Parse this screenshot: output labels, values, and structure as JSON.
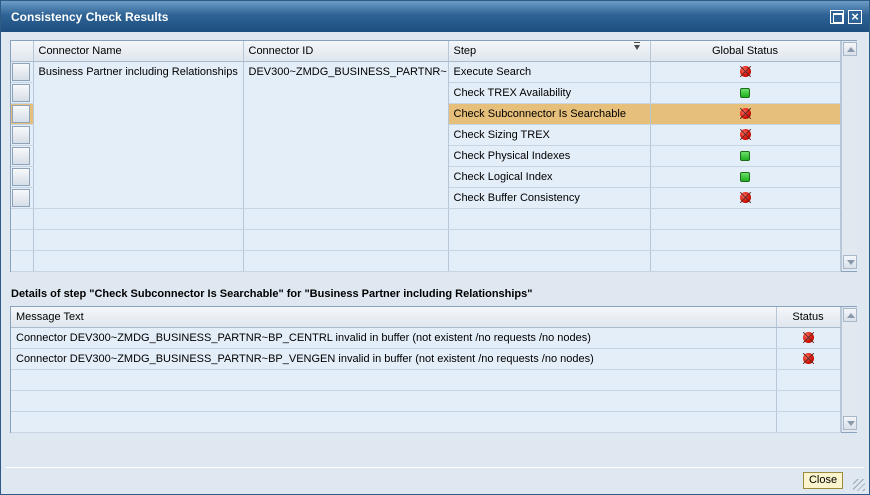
{
  "window": {
    "title": "Consistency Check Results"
  },
  "results_table": {
    "columns": [
      "Connector Name",
      "Connector ID",
      "Step",
      "Global Status"
    ],
    "connector_name": "Business Partner including Relationships",
    "connector_id": "DEV300~ZMDG_BUSINESS_PARTNR~",
    "rows": [
      {
        "step": "Execute Search",
        "status": "red"
      },
      {
        "step": "Check TREX Availability",
        "status": "green"
      },
      {
        "step": "Check Subconnector Is Searchable",
        "status": "red",
        "selected": true
      },
      {
        "step": "Check Sizing TREX",
        "status": "red"
      },
      {
        "step": "Check Physical Indexes",
        "status": "green"
      },
      {
        "step": "Check Logical Index",
        "status": "green"
      },
      {
        "step": "Check Buffer Consistency",
        "status": "red"
      }
    ]
  },
  "details": {
    "title": "Details of step \"Check Subconnector Is Searchable\" for \"Business Partner including Relationships\"",
    "columns": [
      "Message Text",
      "Status"
    ],
    "rows": [
      {
        "text": "Connector DEV300~ZMDG_BUSINESS_PARTNR~BP_CENTRL invalid in buffer (not existent /no requests /no nodes)",
        "status": "red"
      },
      {
        "text": "Connector DEV300~ZMDG_BUSINESS_PARTNR~BP_VENGEN invalid in buffer (not existent /no requests /no nodes)",
        "status": "red"
      }
    ]
  },
  "footer": {
    "close_label": "Close"
  },
  "colors": {
    "title_bar": "#2f6395",
    "selected_row": "#e6bf7b",
    "status_red": "#d20f00",
    "status_green": "#21b021"
  }
}
